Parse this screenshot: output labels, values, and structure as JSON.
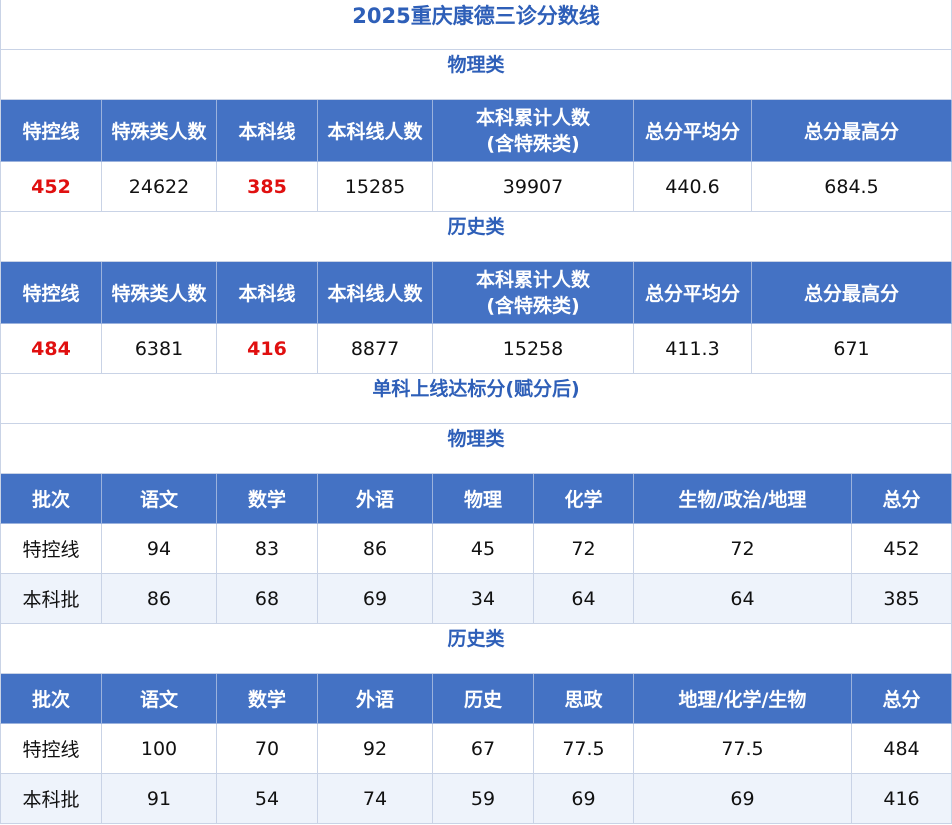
{
  "title": "2025重庆康德三诊分数线",
  "physics_label": "物理类",
  "history_label": "历史类",
  "single_title": "单科上线达标分(赋分后)",
  "score_headers": [
    "特控线",
    "特殊类人数",
    "本科线",
    "本科线人数",
    "本科累计人数",
    "(含特殊类)",
    "总分平均分",
    "总分最高分"
  ],
  "physics_scores": [
    "452",
    "24622",
    "385",
    "15285",
    "39907",
    "440.6",
    "684.5"
  ],
  "history_scores": [
    "484",
    "6381",
    "416",
    "8877",
    "15258",
    "411.3",
    "671"
  ],
  "physics_subject_headers": [
    "批次",
    "语文",
    "数学",
    "外语",
    "物理",
    "化学",
    "生物/政治/地理",
    "总分"
  ],
  "physics_subject_rows": [
    [
      "特控线",
      "94",
      "83",
      "86",
      "45",
      "72",
      "72",
      "452"
    ],
    [
      "本科批",
      "86",
      "68",
      "69",
      "34",
      "64",
      "64",
      "385"
    ]
  ],
  "history_subject_headers": [
    "批次",
    "语文",
    "数学",
    "外语",
    "历史",
    "思政",
    "地理/化学/生物",
    "总分"
  ],
  "history_subject_rows": [
    [
      "特控线",
      "100",
      "70",
      "92",
      "67",
      "77.5",
      "77.5",
      "484"
    ],
    [
      "本科批",
      "91",
      "54",
      "74",
      "59",
      "69",
      "69",
      "416"
    ]
  ]
}
